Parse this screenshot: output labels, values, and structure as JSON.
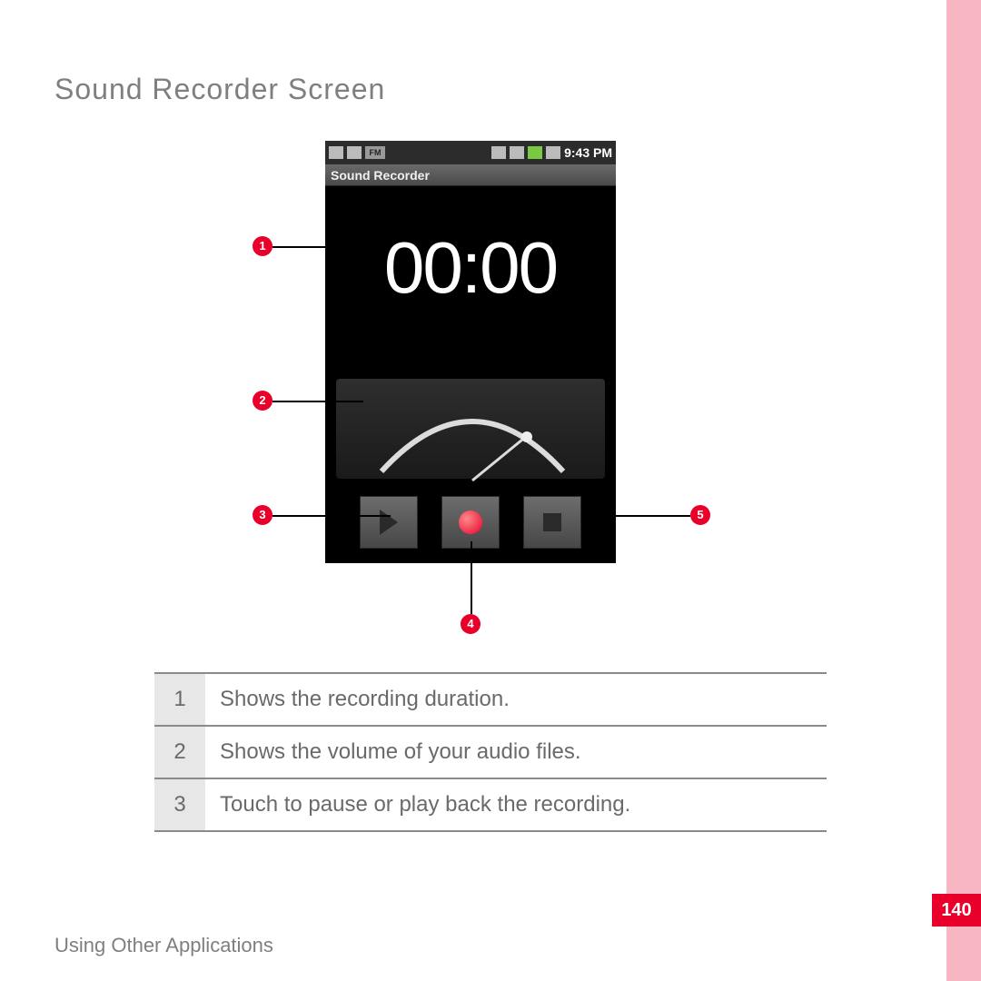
{
  "page": {
    "title": "Sound Recorder Screen",
    "footer": "Using Other Applications",
    "page_number": "140"
  },
  "phone": {
    "status": {
      "fm_label": "FM",
      "time": "9:43 PM"
    },
    "titlebar": "Sound Recorder",
    "timer": "00:00"
  },
  "callouts": [
    {
      "n": "1"
    },
    {
      "n": "2"
    },
    {
      "n": "3"
    },
    {
      "n": "4"
    },
    {
      "n": "5"
    }
  ],
  "descriptions": [
    {
      "n": "1",
      "text": "Shows the recording duration."
    },
    {
      "n": "2",
      "text": "Shows the volume of your audio files."
    },
    {
      "n": "3",
      "text": "Touch to pause or play back the recording."
    }
  ]
}
